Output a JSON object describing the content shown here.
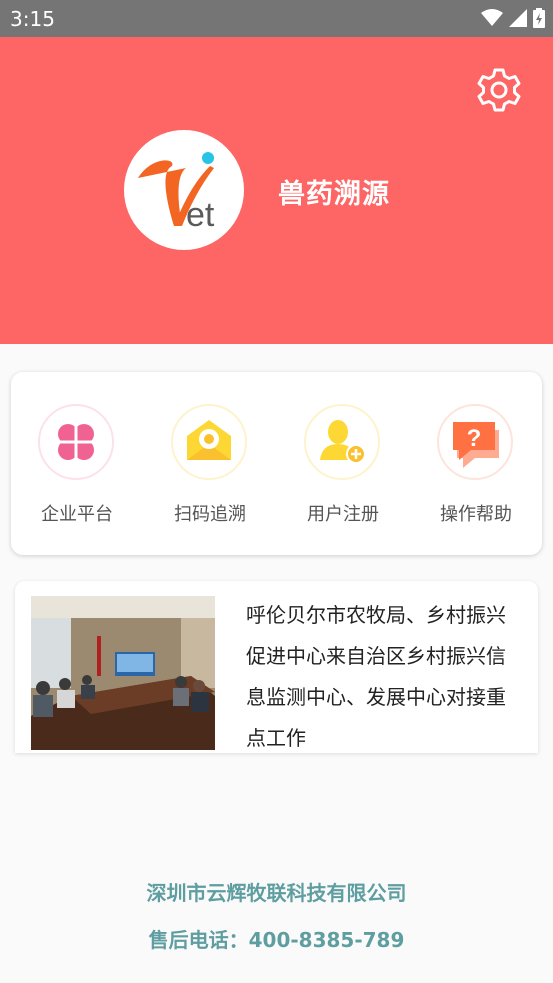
{
  "status_bar": {
    "time": "3:15"
  },
  "header": {
    "title": "兽药溯源",
    "logo_text": "Vet"
  },
  "menu": [
    {
      "label": "企业平台",
      "icon": "clover-icon",
      "color": "#f06292"
    },
    {
      "label": "扫码追溯",
      "icon": "scan-icon",
      "color": "#fbc02d"
    },
    {
      "label": "用户注册",
      "icon": "add-user-icon",
      "color": "#fbc02d"
    },
    {
      "label": "操作帮助",
      "icon": "help-icon",
      "color": "#ff7043"
    }
  ],
  "news": {
    "title": "呼伦贝尔市农牧局、乡村振兴促进中心来自治区乡村振兴信息监测中心、发展中心对接重点工作"
  },
  "footer": {
    "company": "深圳市云辉牧联科技有限公司",
    "phone": "售后电话：400-8385-789"
  },
  "colors": {
    "header": "#fe6565",
    "footer_text": "#5f9ea0"
  }
}
